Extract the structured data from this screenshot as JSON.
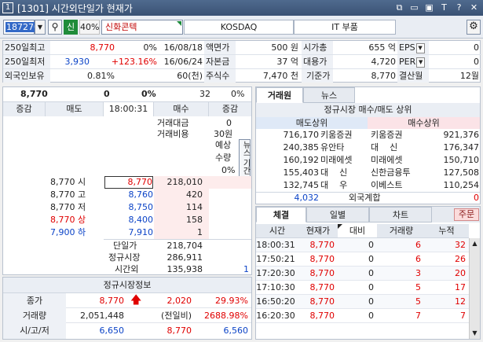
{
  "window": {
    "num": "1",
    "title": "[1301] 시간외단일가 현재가",
    "buttons": [
      "⧉",
      "▭",
      "▣",
      "T",
      "?",
      "✕"
    ]
  },
  "toolbar": {
    "code": "187270",
    "badge": "신",
    "ratio": "40%",
    "name": "신화콘텍",
    "market": "KOSDAQ",
    "sector": "IT 부품"
  },
  "info": [
    {
      "l1": "250일최고",
      "v1": "8,770",
      "c1": "red",
      "p1": "0%",
      "d1": "16/08/18",
      "l2": "액면가",
      "v2": "500 원",
      "l3": "시가총",
      "v3": "655 억",
      "l4": "EPS",
      "v4": "0"
    },
    {
      "l1": "250일최저",
      "v1": "3,930",
      "c1": "blue",
      "p1": "+123.16%",
      "pc": "red",
      "d1": "16/06/24",
      "l2": "자본금",
      "v2": "37 억",
      "l3": "대용가",
      "v3": "4,720",
      "l4": "PER",
      "v4": "0"
    },
    {
      "l1": "외국인보유",
      "v1": "0.81%",
      "c1": "",
      "p1": "60(천)",
      "d1": "",
      "l2": "주식수",
      "v2": "7,470 천",
      "l3": "기준가",
      "v3": "8,770",
      "l4": "결산월",
      "v4": "12월"
    }
  ],
  "summary": {
    "price": "8,770",
    "change": "0",
    "pct": "0%",
    "volume": "32",
    "vpct": "0%"
  },
  "orderbook": {
    "headers": [
      "증감",
      "매도",
      "18:00:31",
      "매수",
      "증감"
    ],
    "side": {
      "amount_label": "거래대금",
      "amount": "0",
      "cost_label": "거래비용",
      "cost": "30원",
      "exp_label": "예상",
      "qty_label": "수량",
      "exp_pct": "0%",
      "news": "뉴스",
      "period": "기간"
    },
    "rows": [
      {
        "label": "8,770 시",
        "color": "",
        "price": "8,770",
        "pcolor": "red",
        "qty": "218,010"
      },
      {
        "label": "8,770 고",
        "color": "",
        "price": "8,760",
        "pcolor": "blue",
        "qty": "420"
      },
      {
        "label": "8,770 저",
        "color": "",
        "price": "8,750",
        "pcolor": "blue",
        "qty": "114"
      },
      {
        "label": "8,770 상",
        "color": "red",
        "price": "8,400",
        "pcolor": "blue",
        "qty": "158"
      },
      {
        "label": "7,900 하",
        "color": "blue",
        "price": "7,910",
        "pcolor": "blue",
        "qty": "1"
      }
    ],
    "totals": [
      {
        "label": "단일가",
        "value": "218,704"
      },
      {
        "label": "정규시장",
        "value": "286,911"
      },
      {
        "label": "시간외",
        "value": "135,938",
        "extra": "1"
      }
    ]
  },
  "bottom": {
    "title": "정규시장정보",
    "rows": [
      {
        "l": "종가",
        "a": "8,770",
        "ac": "red",
        "b": "2,020",
        "bc": "red",
        "c": "29.93%",
        "cc": "red",
        "arrow": true
      },
      {
        "l": "거래량",
        "a": "2,051,448",
        "ac": "",
        "b": "(전일비)",
        "bc": "",
        "c": "2688.98%",
        "cc": "red"
      },
      {
        "l": "시/고/저",
        "a": "6,650",
        "ac": "blue",
        "b": "8,770",
        "bc": "red",
        "c": "6,560",
        "cc": "blue"
      }
    ]
  },
  "right_tabs": [
    "거래원",
    "뉴스"
  ],
  "broker": {
    "title": "정규시장 매수/매도 상위",
    "sell_h": "매도상위",
    "buy_h": "매수상위",
    "rows": [
      {
        "sv": "716,170",
        "sn": "키움증권",
        "bn": "키움증권",
        "bv": "921,376"
      },
      {
        "sv": "240,385",
        "sn": "유안타",
        "bn": "대    신",
        "bv": "176,347"
      },
      {
        "sv": "160,192",
        "sn": "미래에셋",
        "bn": "미래에셋",
        "bv": "150,710"
      },
      {
        "sv": "155,403",
        "sn": "대    신",
        "bn": "신한금융투",
        "bv": "127,508"
      },
      {
        "sv": "132,745",
        "sn": "대    우",
        "bn": "이베스트",
        "bv": "110,254"
      }
    ],
    "foreign_sell": "4,032",
    "foreign_label": "외국계합",
    "foreign_buy": "0"
  },
  "trade_tabs": [
    "체결",
    "일별",
    "차트"
  ],
  "order_btn": "주문",
  "trades": {
    "headers": [
      "시간",
      "현재가",
      "대비",
      "거래량",
      "누적"
    ],
    "rows": [
      {
        "t": "18:00:31",
        "p": "8,770",
        "d": "0",
        "v": "6",
        "a": "32"
      },
      {
        "t": "17:50:21",
        "p": "8,770",
        "d": "0",
        "v": "6",
        "a": "26"
      },
      {
        "t": "17:20:30",
        "p": "8,770",
        "d": "0",
        "v": "3",
        "a": "20"
      },
      {
        "t": "17:10:30",
        "p": "8,770",
        "d": "0",
        "v": "5",
        "a": "17"
      },
      {
        "t": "16:50:20",
        "p": "8,770",
        "d": "0",
        "v": "5",
        "a": "12"
      },
      {
        "t": "16:20:30",
        "p": "8,770",
        "d": "0",
        "v": "7",
        "a": "7"
      }
    ]
  }
}
